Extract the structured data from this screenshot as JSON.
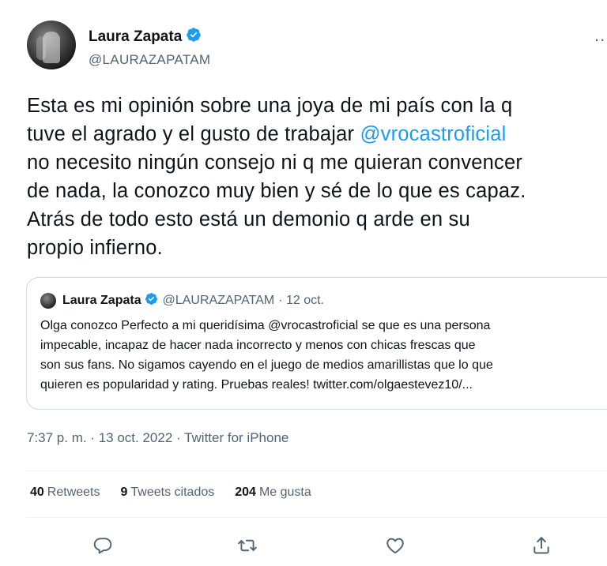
{
  "tweet": {
    "author_name": "Laura Zapata",
    "author_handle": "@LAURAZAPATAM",
    "more_label": "...",
    "text_before_mention": "Esta es mi opinión sobre una joya de mi país con la q\ntuve el agrado y el gusto de trabajar ",
    "mention": "@vrocastroficial",
    "text_after_mention": "\nno necesito ningún consejo ni q me quieran convencer\nde nada, la conozco muy bien y sé de lo que es capaz.\nAtrás de todo esto está un demonio q arde en su\npropio infierno.",
    "timestamp": "7:37 p. m. · 13 oct. 2022 · Twitter for iPhone"
  },
  "quote": {
    "author_name": "Laura Zapata",
    "author_handle": "@LAURAZAPATAM",
    "date": "· 12 oct.",
    "text": "Olga conozco Perfecto a mi queridísima @vrocastroficial se que es una persona\nimpecable, incapaz de hacer nada incorrecto y menos con chicas frescas que\nson sus fans. No sigamos cayendo en el juego de medios amarillistas que lo que\nquieren es popularidad y rating. Pruebas reales! twitter.com/olgaestevez10/..."
  },
  "stats": {
    "retweets_count": "40",
    "retweets_label": "Retweets",
    "quotes_count": "9",
    "quotes_label": "Tweets citados",
    "likes_count": "204",
    "likes_label": "Me gusta"
  },
  "actions": [
    "reply-icon",
    "retweet-icon",
    "like-icon",
    "share-icon"
  ],
  "colors": {
    "text": "#0f1419",
    "secondary": "#536471",
    "accent": "#1d9bf0",
    "border": "#cfd9de"
  }
}
